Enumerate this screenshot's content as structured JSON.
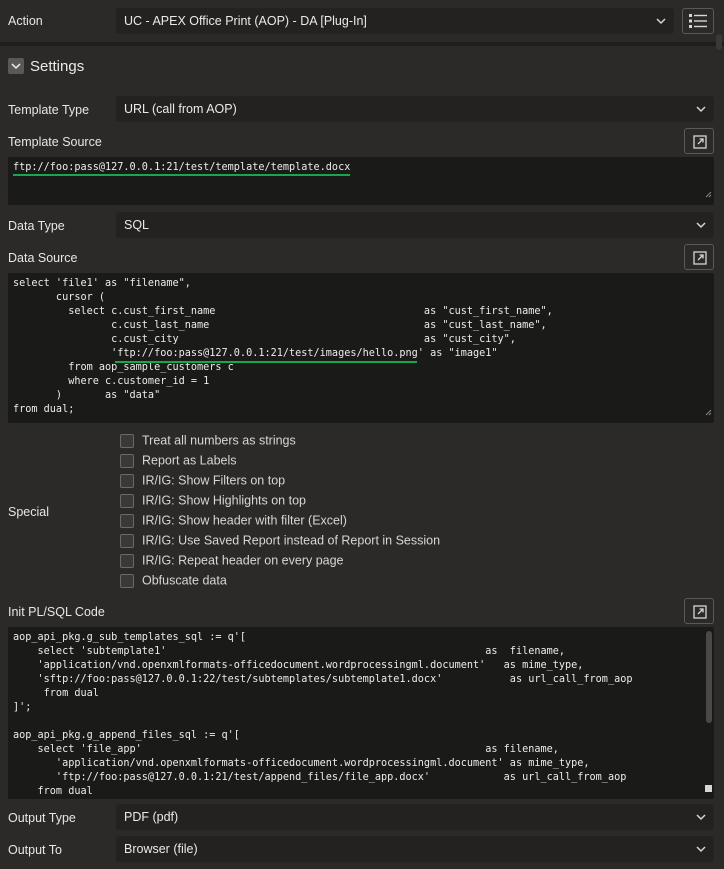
{
  "action": {
    "label": "Action",
    "value": "UC - APEX Office Print (AOP) - DA [Plug-In]"
  },
  "settings": {
    "title": "Settings"
  },
  "template_type": {
    "label": "Template Type",
    "value": "URL (call from AOP)"
  },
  "template_source": {
    "label": "Template Source",
    "value": "ftp://foo:pass@127.0.0.1:21/test/template/template.docx"
  },
  "data_type": {
    "label": "Data Type",
    "value": "SQL"
  },
  "data_source": {
    "label": "Data Source",
    "lines": [
      "select 'file1' as \"filename\",",
      "       cursor (",
      "         select c.cust_first_name                                  as \"cust_first_name\",",
      "                c.cust_last_name                                   as \"cust_last_name\",",
      "                c.cust_city                                        as \"cust_city\",",
      "                'ftp://foo:pass@127.0.0.1:21/test/images/hello.png' as \"image1\"",
      "         from aop_sample_customers c",
      "         where c.customer_id = 1",
      "       )       as \"data\"",
      "from dual;"
    ]
  },
  "special": {
    "label": "Special",
    "options": [
      "Treat all numbers as strings",
      "Report as Labels",
      "IR/IG: Show Filters on top",
      "IR/IG: Show Highlights on top",
      "IR/IG: Show header with filter (Excel)",
      "IR/IG: Use Saved Report instead of Report in Session",
      "IR/IG: Repeat header on every page",
      "Obfuscate data"
    ]
  },
  "init_plsql": {
    "label": "Init PL/SQL Code",
    "lines": [
      "aop_api_pkg.g_sub_templates_sql := q'[",
      "    select 'subtemplate1'                                                    as  filename,",
      "    'application/vnd.openxmlformats-officedocument.wordprocessingml.document'   as mime_type,",
      "    'sftp://foo:pass@127.0.0.1:22/test/subtemplates/subtemplate1.docx'           as url_call_from_aop",
      "     from dual",
      "]';",
      "",
      "aop_api_pkg.g_append_files_sql := q'[",
      "    select 'file_app'                                                        as filename,",
      "       'application/vnd.openxmlformats-officedocument.wordprocessingml.document' as mime_type,",
      "       'ftp://foo:pass@127.0.0.1:21/test/append_files/file_app.docx'            as url_call_from_aop",
      "    from dual"
    ]
  },
  "output_type": {
    "label": "Output Type",
    "value": "PDF (pdf)"
  },
  "output_to": {
    "label": "Output To",
    "value": "Browser (file)"
  },
  "colors": {
    "background": "#2b2a29",
    "field": "#232221",
    "code": "#1a1a19",
    "underline": "#14a84b"
  }
}
